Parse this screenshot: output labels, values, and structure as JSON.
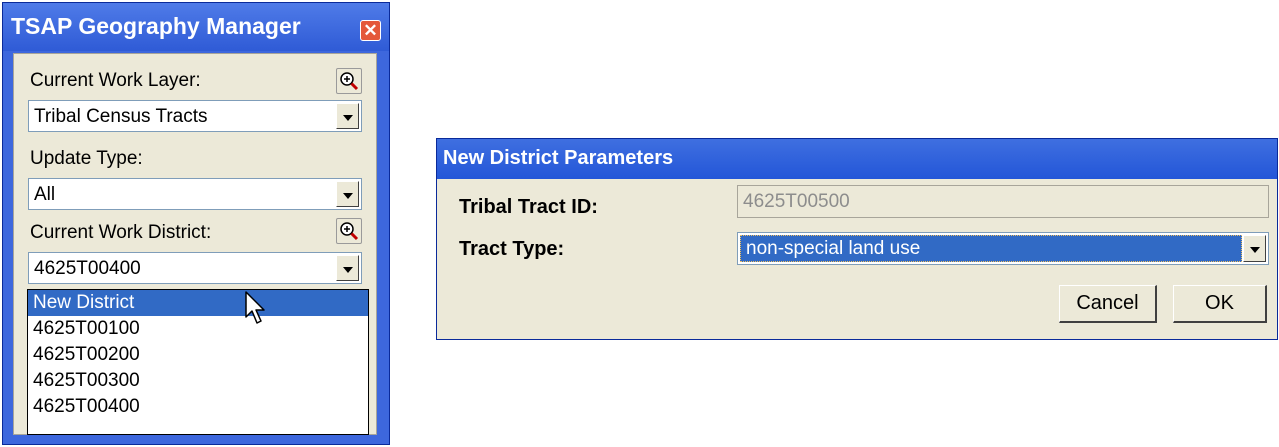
{
  "geo_manager": {
    "title": "TSAP Geography Manager",
    "current_work_layer_label": "Current Work Layer:",
    "current_work_layer_value": "Tribal Census Tracts",
    "update_type_label": "Update Type:",
    "update_type_value": "All",
    "current_work_district_label": "Current Work District:",
    "current_work_district_value": "4625T00400",
    "district_options": [
      "New District",
      "4625T00100",
      "4625T00200",
      "4625T00300",
      "4625T00400"
    ],
    "highlighted_option": "New District"
  },
  "new_district": {
    "title": "New District Parameters",
    "tribal_tract_id_label": "Tribal Tract ID:",
    "tribal_tract_id_value": "4625T00500",
    "tract_type_label": "Tract Type:",
    "tract_type_value": "non-special land use",
    "cancel_label": "Cancel",
    "ok_label": "OK"
  },
  "icons": [
    "zoom-in-icon",
    "close-icon",
    "chevron-down-icon",
    "mouse-cursor-icon"
  ],
  "colors": {
    "titlebar": "#3d67dd",
    "selection": "#316ac5",
    "close": "#e4583a",
    "dialog_bg": "#ece9d8"
  }
}
